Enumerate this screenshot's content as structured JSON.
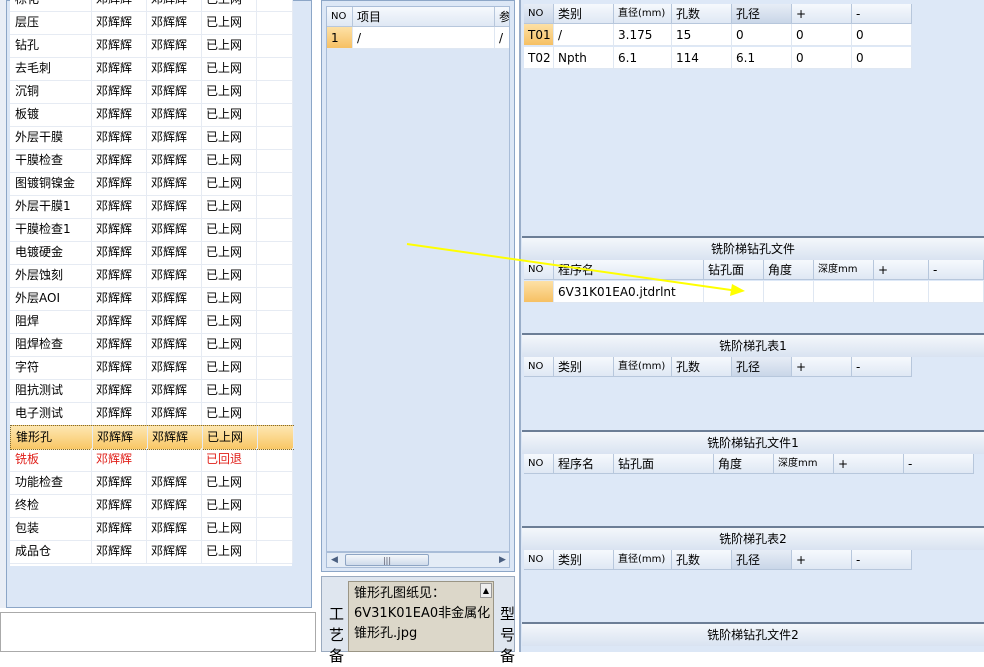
{
  "left_table": {
    "rows": [
      {
        "step": "棕化",
        "c1": "邓辉辉",
        "c2": "邓辉辉",
        "status": "已上网"
      },
      {
        "step": "层压",
        "c1": "邓辉辉",
        "c2": "邓辉辉",
        "status": "已上网"
      },
      {
        "step": "钻孔",
        "c1": "邓辉辉",
        "c2": "邓辉辉",
        "status": "已上网"
      },
      {
        "step": "去毛刺",
        "c1": "邓辉辉",
        "c2": "邓辉辉",
        "status": "已上网"
      },
      {
        "step": "沉铜",
        "c1": "邓辉辉",
        "c2": "邓辉辉",
        "status": "已上网"
      },
      {
        "step": "板镀",
        "c1": "邓辉辉",
        "c2": "邓辉辉",
        "status": "已上网"
      },
      {
        "step": "外层干膜",
        "c1": "邓辉辉",
        "c2": "邓辉辉",
        "status": "已上网"
      },
      {
        "step": "干膜检查",
        "c1": "邓辉辉",
        "c2": "邓辉辉",
        "status": "已上网"
      },
      {
        "step": "图镀铜镍金",
        "c1": "邓辉辉",
        "c2": "邓辉辉",
        "status": "已上网"
      },
      {
        "step": "外层干膜1",
        "c1": "邓辉辉",
        "c2": "邓辉辉",
        "status": "已上网"
      },
      {
        "step": "干膜检查1",
        "c1": "邓辉辉",
        "c2": "邓辉辉",
        "status": "已上网"
      },
      {
        "step": "电镀硬金",
        "c1": "邓辉辉",
        "c2": "邓辉辉",
        "status": "已上网"
      },
      {
        "step": "外层蚀刻",
        "c1": "邓辉辉",
        "c2": "邓辉辉",
        "status": "已上网"
      },
      {
        "step": "外层AOI",
        "c1": "邓辉辉",
        "c2": "邓辉辉",
        "status": "已上网"
      },
      {
        "step": "阻焊",
        "c1": "邓辉辉",
        "c2": "邓辉辉",
        "status": "已上网"
      },
      {
        "step": "阻焊检查",
        "c1": "邓辉辉",
        "c2": "邓辉辉",
        "status": "已上网"
      },
      {
        "step": "字符",
        "c1": "邓辉辉",
        "c2": "邓辉辉",
        "status": "已上网"
      },
      {
        "step": "阻抗测试",
        "c1": "邓辉辉",
        "c2": "邓辉辉",
        "status": "已上网"
      },
      {
        "step": "电子测试",
        "c1": "邓辉辉",
        "c2": "邓辉辉",
        "status": "已上网"
      },
      {
        "step": "锥形孔",
        "c1": "邓辉辉",
        "c2": "邓辉辉",
        "status": "已上网",
        "selected": true
      },
      {
        "step": "铣板",
        "c1": "邓辉辉",
        "c2": "",
        "status": "已回退",
        "returned": true
      },
      {
        "step": "功能检查",
        "c1": "邓辉辉",
        "c2": "邓辉辉",
        "status": "已上网"
      },
      {
        "step": "终检",
        "c1": "邓辉辉",
        "c2": "邓辉辉",
        "status": "已上网"
      },
      {
        "step": "包装",
        "c1": "邓辉辉",
        "c2": "邓辉辉",
        "status": "已上网"
      },
      {
        "step": "成品仓",
        "c1": "邓辉辉",
        "c2": "邓辉辉",
        "status": "已上网"
      }
    ]
  },
  "params_table": {
    "headers": [
      "NO",
      "项目",
      "参"
    ],
    "rows": [
      [
        "1",
        "/",
        "/"
      ]
    ]
  },
  "notes": {
    "process_label": "工艺备",
    "text": "锥形孔图纸见：6V31K01EA0非金属化锥形孔.jpg",
    "model_label": "型号备",
    "scroll_up": "▲"
  },
  "drill_table": {
    "headers": [
      "NO",
      "类别",
      "直径(mm)",
      "孔数",
      "孔径",
      "+",
      "-"
    ],
    "rows": [
      [
        "T01",
        "/",
        "3.175",
        "15",
        "0",
        "0",
        "0"
      ],
      [
        "T02",
        "Npth",
        "6.1",
        "114",
        "6.1",
        "0",
        "0"
      ]
    ]
  },
  "sections": [
    {
      "title": "铣阶梯钻孔文件",
      "headers": [
        "NO",
        "程序名",
        "",
        "钻孔面",
        "角度",
        "深度mm",
        "+",
        "-"
      ],
      "rows": [
        [
          "",
          "6V31K01EA0.jtdrlnt",
          "",
          "",
          "",
          "",
          "",
          ""
        ]
      ]
    },
    {
      "title": "铣阶梯孔表1",
      "headers": [
        "NO",
        "类别",
        "直径(mm)",
        "孔数",
        "孔径",
        "+",
        "-"
      ]
    },
    {
      "title": "铣阶梯钻孔文件1",
      "headers": [
        "NO",
        "程序名",
        "钻孔面",
        "角度",
        "深度mm",
        "+",
        "-"
      ]
    },
    {
      "title": "铣阶梯孔表2",
      "headers": [
        "NO",
        "类别",
        "直径(mm)",
        "孔数",
        "孔径",
        "+",
        "-"
      ]
    },
    {
      "title": "铣阶梯钻孔文件2"
    }
  ],
  "colors": {
    "accent_selected": "#f9c765",
    "returned_text": "#e0201a",
    "arrow": "#ffff00"
  },
  "scrollbar": {
    "left": "◀",
    "right": "▶",
    "grip": "|||"
  }
}
